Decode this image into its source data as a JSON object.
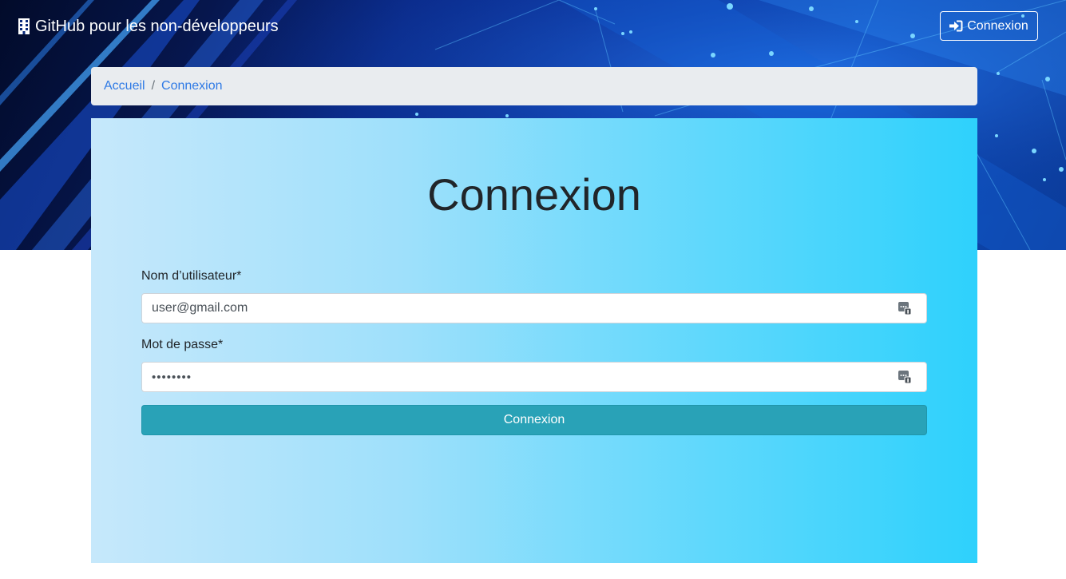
{
  "navbar": {
    "brand_text": "GitHub pour les non-développeurs",
    "brand_icon": "building-icon",
    "login_button_label": "Connexion",
    "login_icon": "sign-in-icon"
  },
  "breadcrumb": {
    "items": [
      "Accueil",
      "Connexion"
    ]
  },
  "form": {
    "title": "Connexion",
    "username_label": "Nom d’utilisateur*",
    "username_value": "user@gmail.com",
    "password_label": "Mot de passe*",
    "password_value": "••••••••",
    "field_icon": "password-manager-icon",
    "submit_label": "Connexion"
  },
  "colors": {
    "primary_link": "#2f7ae5",
    "submit_bg": "#29a2b7",
    "card_gradient_start": "#c6e8fb",
    "card_gradient_end": "#2ed1fc"
  }
}
